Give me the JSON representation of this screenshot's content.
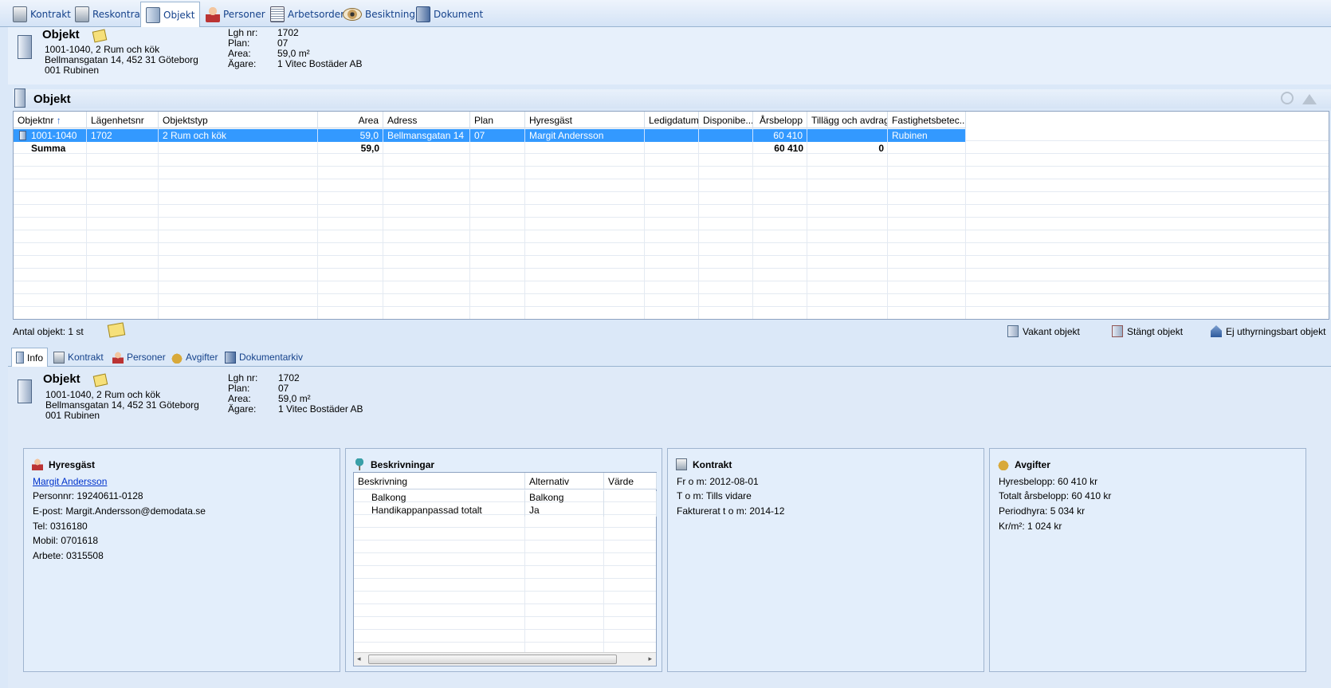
{
  "top_tabs": [
    {
      "label": "Kontrakt",
      "icon": "contract-icon"
    },
    {
      "label": "Reskontra",
      "icon": "ledger-icon"
    },
    {
      "label": "Objekt",
      "icon": "door-icon"
    },
    {
      "label": "Personer",
      "icon": "person-icon"
    },
    {
      "label": "Arbetsorder",
      "icon": "list-icon"
    },
    {
      "label": "Besiktning",
      "icon": "eye-icon"
    },
    {
      "label": "Dokument",
      "icon": "binder-icon"
    }
  ],
  "header": {
    "title": "Objekt",
    "line1": "1001-1040,  2 Rum och kök",
    "line2": "Bellmansgatan 14, 452 31 Göteborg",
    "line3": "001 Rubinen",
    "fields": [
      {
        "label": "Lgh nr:",
        "value": "1702"
      },
      {
        "label": "Plan:",
        "value": "07"
      },
      {
        "label": "Area:",
        "value": "59,0 m²"
      },
      {
        "label": "Ägare:",
        "value": "1 Vitec Bostäder AB"
      }
    ]
  },
  "list_section": {
    "title": "Objekt"
  },
  "grid": {
    "columns": [
      "Objektnr",
      "Lägenhetsnr",
      "Objektstyp",
      "Area",
      "Adress",
      "Plan",
      "Hyresgäst",
      "Ledigdatum",
      "Disponibe...",
      "Årsbelopp",
      "Tillägg och avdrag",
      "Fastighetsbetec..."
    ],
    "rows": [
      {
        "objektnr": "1001-1040",
        "lagenhetsnr": "1702",
        "objektstyp": "2 Rum och kök",
        "area": "59,0",
        "adress": "Bellmansgatan 14",
        "plan": "07",
        "hyresgast": "Margit Andersson",
        "ledigdatum": "",
        "disponibel": "",
        "arsbelopp": "60 410",
        "tillagg": "",
        "fastighet": "Rubinen"
      }
    ],
    "summary": {
      "label": "Summa",
      "area": "59,0",
      "arsbelopp": "60 410",
      "tillagg": "0"
    }
  },
  "footer": {
    "count": "Antal objekt: 1 st",
    "vakant": "Vakant objekt",
    "stangt": "Stängt objekt",
    "ej_uthyrning": "Ej uthyrningsbart objekt"
  },
  "bottom_tabs": [
    {
      "label": "Info"
    },
    {
      "label": "Kontrakt"
    },
    {
      "label": "Personer"
    },
    {
      "label": "Avgifter"
    },
    {
      "label": "Dokumentarkiv"
    }
  ],
  "info_header": {
    "title": "Objekt",
    "line1": "1001-1040,  2 Rum och kök",
    "line2": "Bellmansgatan 14, 452 31 Göteborg",
    "line3": "001 Rubinen",
    "fields": [
      {
        "label": "Lgh nr:",
        "value": "1702"
      },
      {
        "label": "Plan:",
        "value": "07"
      },
      {
        "label": "Area:",
        "value": "59,0 m²"
      },
      {
        "label": "Ägare:",
        "value": "1 Vitec Bostäder AB"
      }
    ]
  },
  "panels": {
    "hyresgast": {
      "title": "Hyresgäst",
      "name": "Margit Andersson",
      "lines": [
        "Personnr: 19240611-0128",
        "E-post: Margit.Andersson@demodata.se",
        "Tel: 0316180",
        "Mobil: 0701618",
        "Arbete: 0315508"
      ]
    },
    "beskrivningar": {
      "title": "Beskrivningar",
      "columns": [
        "Beskrivning",
        "Alternativ",
        "Värde"
      ],
      "rows": [
        {
          "beskrivning": "Balkong",
          "alternativ": "Balkong",
          "varde": ""
        },
        {
          "beskrivning": "Handikappanpassad totalt",
          "alternativ": "Ja",
          "varde": ""
        }
      ]
    },
    "kontrakt": {
      "title": "Kontrakt",
      "lines": [
        "Fr o m: 2012-08-01",
        "T o m: Tills vidare",
        "Fakturerat t o m: 2014-12"
      ]
    },
    "avgifter": {
      "title": "Avgifter",
      "lines": [
        "Hyresbelopp: 60 410 kr",
        "Totalt årsbelopp: 60 410 kr",
        "Periodhyra: 5 034 kr",
        "Kr/m²: 1 024 kr"
      ]
    }
  }
}
